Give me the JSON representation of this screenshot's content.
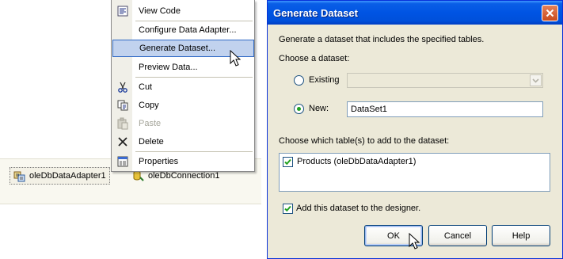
{
  "context_menu": {
    "items": [
      {
        "label": "View Code",
        "icon": "view-code-icon"
      },
      {
        "label": "Configure Data Adapter...",
        "icon": ""
      },
      {
        "label": "Generate Dataset...",
        "icon": "",
        "highlighted": true
      },
      {
        "label": "Preview Data...",
        "icon": ""
      },
      {
        "label": "Cut",
        "icon": "scissors-icon"
      },
      {
        "label": "Copy",
        "icon": "copy-icon"
      },
      {
        "label": "Paste",
        "icon": "paste-icon",
        "disabled": true
      },
      {
        "label": "Delete",
        "icon": "delete-x-icon"
      },
      {
        "label": "Properties",
        "icon": "properties-icon"
      }
    ]
  },
  "tray": {
    "components": [
      {
        "label": "oleDbDataAdapter1",
        "icon": "data-adapter-icon",
        "selected": true
      },
      {
        "label": "oleDbConnection1",
        "icon": "connection-icon"
      }
    ]
  },
  "dialog": {
    "title": "Generate Dataset",
    "description": "Generate a dataset that includes the specified tables.",
    "choose_dataset_label": "Choose a dataset:",
    "existing_label": "Existing",
    "existing_value": "",
    "new_label": "New:",
    "new_value": "DataSet1",
    "selected_option": "new",
    "tables_label": "Choose which table(s) to add to the dataset:",
    "tables": [
      {
        "label": "Products (oleDbDataAdapter1)",
        "checked": true
      }
    ],
    "add_to_designer_label": "Add this dataset to the designer.",
    "add_to_designer_checked": true,
    "buttons": {
      "ok": "OK",
      "cancel": "Cancel",
      "help": "Help"
    }
  },
  "colors": {
    "menu_highlight": "#c1d2ee",
    "titlebar_blue": "#0054e3",
    "dialog_face": "#ece9d8",
    "close_button": "#d65a2a"
  }
}
